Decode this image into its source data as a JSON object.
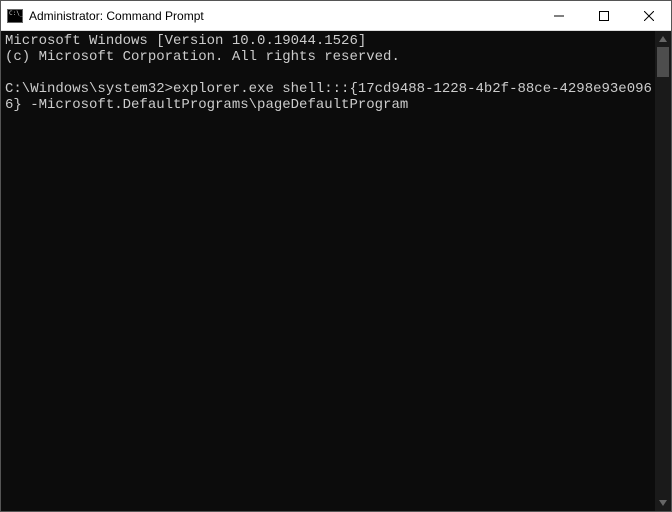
{
  "window": {
    "title": "Administrator: Command Prompt"
  },
  "terminal": {
    "lines": [
      "Microsoft Windows [Version 10.0.19044.1526]",
      "(c) Microsoft Corporation. All rights reserved.",
      "",
      "C:\\Windows\\system32>explorer.exe shell:::{17cd9488-1228-4b2f-88ce-4298e93e0966} -Microsoft.DefaultPrograms\\pageDefaultProgram"
    ]
  }
}
